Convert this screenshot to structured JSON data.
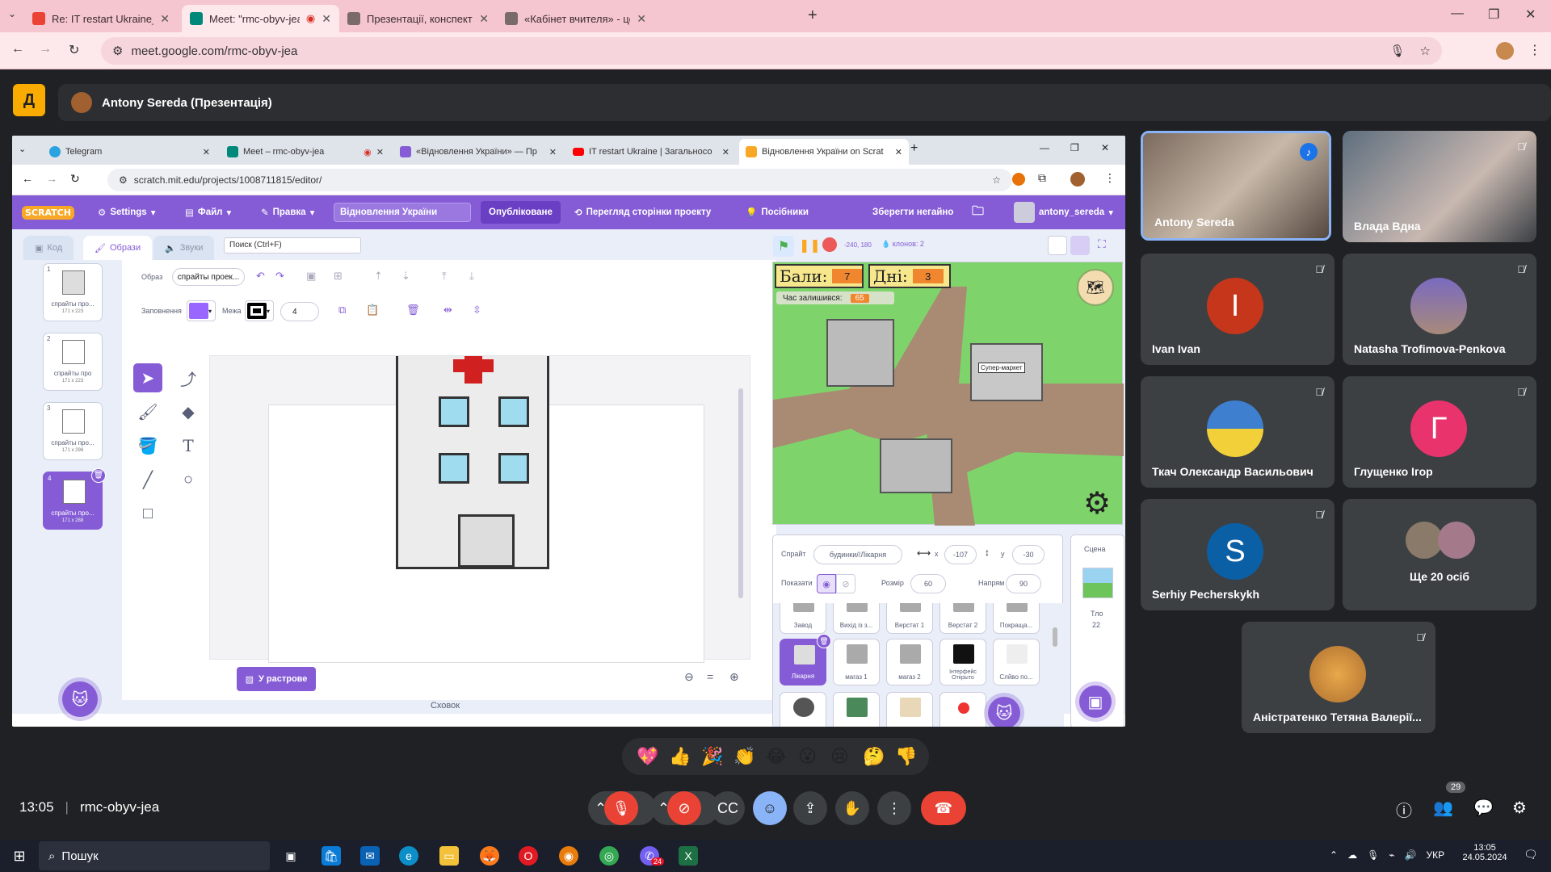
{
  "outer_tabs": [
    {
      "title": "Re: IT restart Ukraine_Фіналісти",
      "favicon": "gmail"
    },
    {
      "title": "Meet: \"rmc-obyv-jea\"",
      "favicon": "meet",
      "active": true
    },
    {
      "title": "Презентації, конспекти до уро",
      "favicon": "doc"
    },
    {
      "title": "«Кабінет вчителя» - це зручна",
      "favicon": "doc"
    }
  ],
  "outer_url": "meet.google.com/rmc-obyv-jea",
  "presenter_label": "Antony Sereda (Презентація)",
  "inner_tabs": [
    {
      "title": "Telegram"
    },
    {
      "title": "Meet – rmc-obyv-jea"
    },
    {
      "title": "«Відновлення України» — Пр"
    },
    {
      "title": "IT restart Ukraine | Загальносо"
    },
    {
      "title": "Відновлення України on Scrat",
      "active": true
    }
  ],
  "inner_url": "scratch.mit.edu/projects/1008711815/editor/",
  "scratch_menu": {
    "logo": "SCRATCH",
    "settings": "Settings",
    "file": "Файл",
    "edit": "Правка",
    "project_title": "Відновлення України",
    "published": "Опубліковане",
    "view_page": "Перегляд сторінки проекту",
    "tutorials": "Посібники",
    "save_now": "Зберегти негайно",
    "username": "antony_sereda"
  },
  "editor_tabs": {
    "code": "Код",
    "costumes": "Образи",
    "sounds": "Звуки"
  },
  "search_placeholder": "Поиск (Ctrl+F)",
  "costumes": [
    {
      "num": "1",
      "name": "спрайты про...",
      "size": "171 x 223"
    },
    {
      "num": "2",
      "name": "спрайты про",
      "size": "171 x 223"
    },
    {
      "num": "3",
      "name": "спрайты про...",
      "size": "171 x 298"
    },
    {
      "num": "4",
      "name": "спрайты про...",
      "size": "171 x 288",
      "selected": true
    }
  ],
  "paint": {
    "costume_label": "Образ",
    "costume_name": "спрайты проек...",
    "fill_label": "Заповнення",
    "outline_label": "Межа",
    "outline_width": "4",
    "raster_button": "У растрове",
    "fill_color": "#9966ff"
  },
  "stage_controls": {
    "coords": "-240, 180",
    "clones": "клонов: 2"
  },
  "hud": {
    "score_label": "Бали:",
    "score": "7",
    "days_label": "Дні:",
    "days": "3",
    "time_label": "Час залишився:",
    "time": "65",
    "shop": "Супер-маркет"
  },
  "sprite_info": {
    "sprite_label": "Спрайт",
    "sprite_name": "будинки//Лікарня",
    "x_label": "x",
    "x": "-107",
    "y_label": "y",
    "y": "-30",
    "show_label": "Показати",
    "size_label": "Розмір",
    "size": "60",
    "direction_label": "Напрям",
    "direction": "90"
  },
  "sprites_row1": [
    "Завод",
    "Вихід із з...",
    "Верстат 1",
    "Верстат 2",
    "Покраща..."
  ],
  "sprites_row2": [
    "Лікарня",
    "магаз 1",
    "магаз 2",
    "Інтерфейс Открыто",
    "Слйво по..."
  ],
  "scene": {
    "label": "Сцена",
    "backdrops_label": "Тло",
    "backdrops": "22"
  },
  "storage_label": "Сховок",
  "participants": [
    {
      "name": "Antony Sereda",
      "type": "video"
    },
    {
      "name": "Влада Вдна",
      "type": "video"
    },
    {
      "name": "Ivan Ivan",
      "initial": "I",
      "color": "#c5361b"
    },
    {
      "name": "Natasha Trofimova-Penkova",
      "type": "photo"
    },
    {
      "name": "Ткач Олександр Васильович",
      "type": "photo"
    },
    {
      "name": "Глущенко Ігор",
      "initial": "Г",
      "color": "#e8336d"
    },
    {
      "name": "Serhiy Pecherskykh",
      "initial": "S",
      "color": "#0b5fa5"
    },
    {
      "name": "Ще 20 осіб",
      "type": "group"
    },
    {
      "name": "Аністратенко Тетяна Валерії...",
      "type": "photo"
    }
  ],
  "reactions": [
    "💖",
    "👍",
    "🎉",
    "👏",
    "😂",
    "😮",
    "😢",
    "🤔",
    "👎"
  ],
  "meeting": {
    "time": "13:05",
    "code": "rmc-obyv-jea",
    "people_count": "29"
  },
  "taskbar": {
    "search": "Пошук",
    "lang": "УКР",
    "time": "13:05",
    "date": "24.05.2024",
    "badge": "24"
  }
}
